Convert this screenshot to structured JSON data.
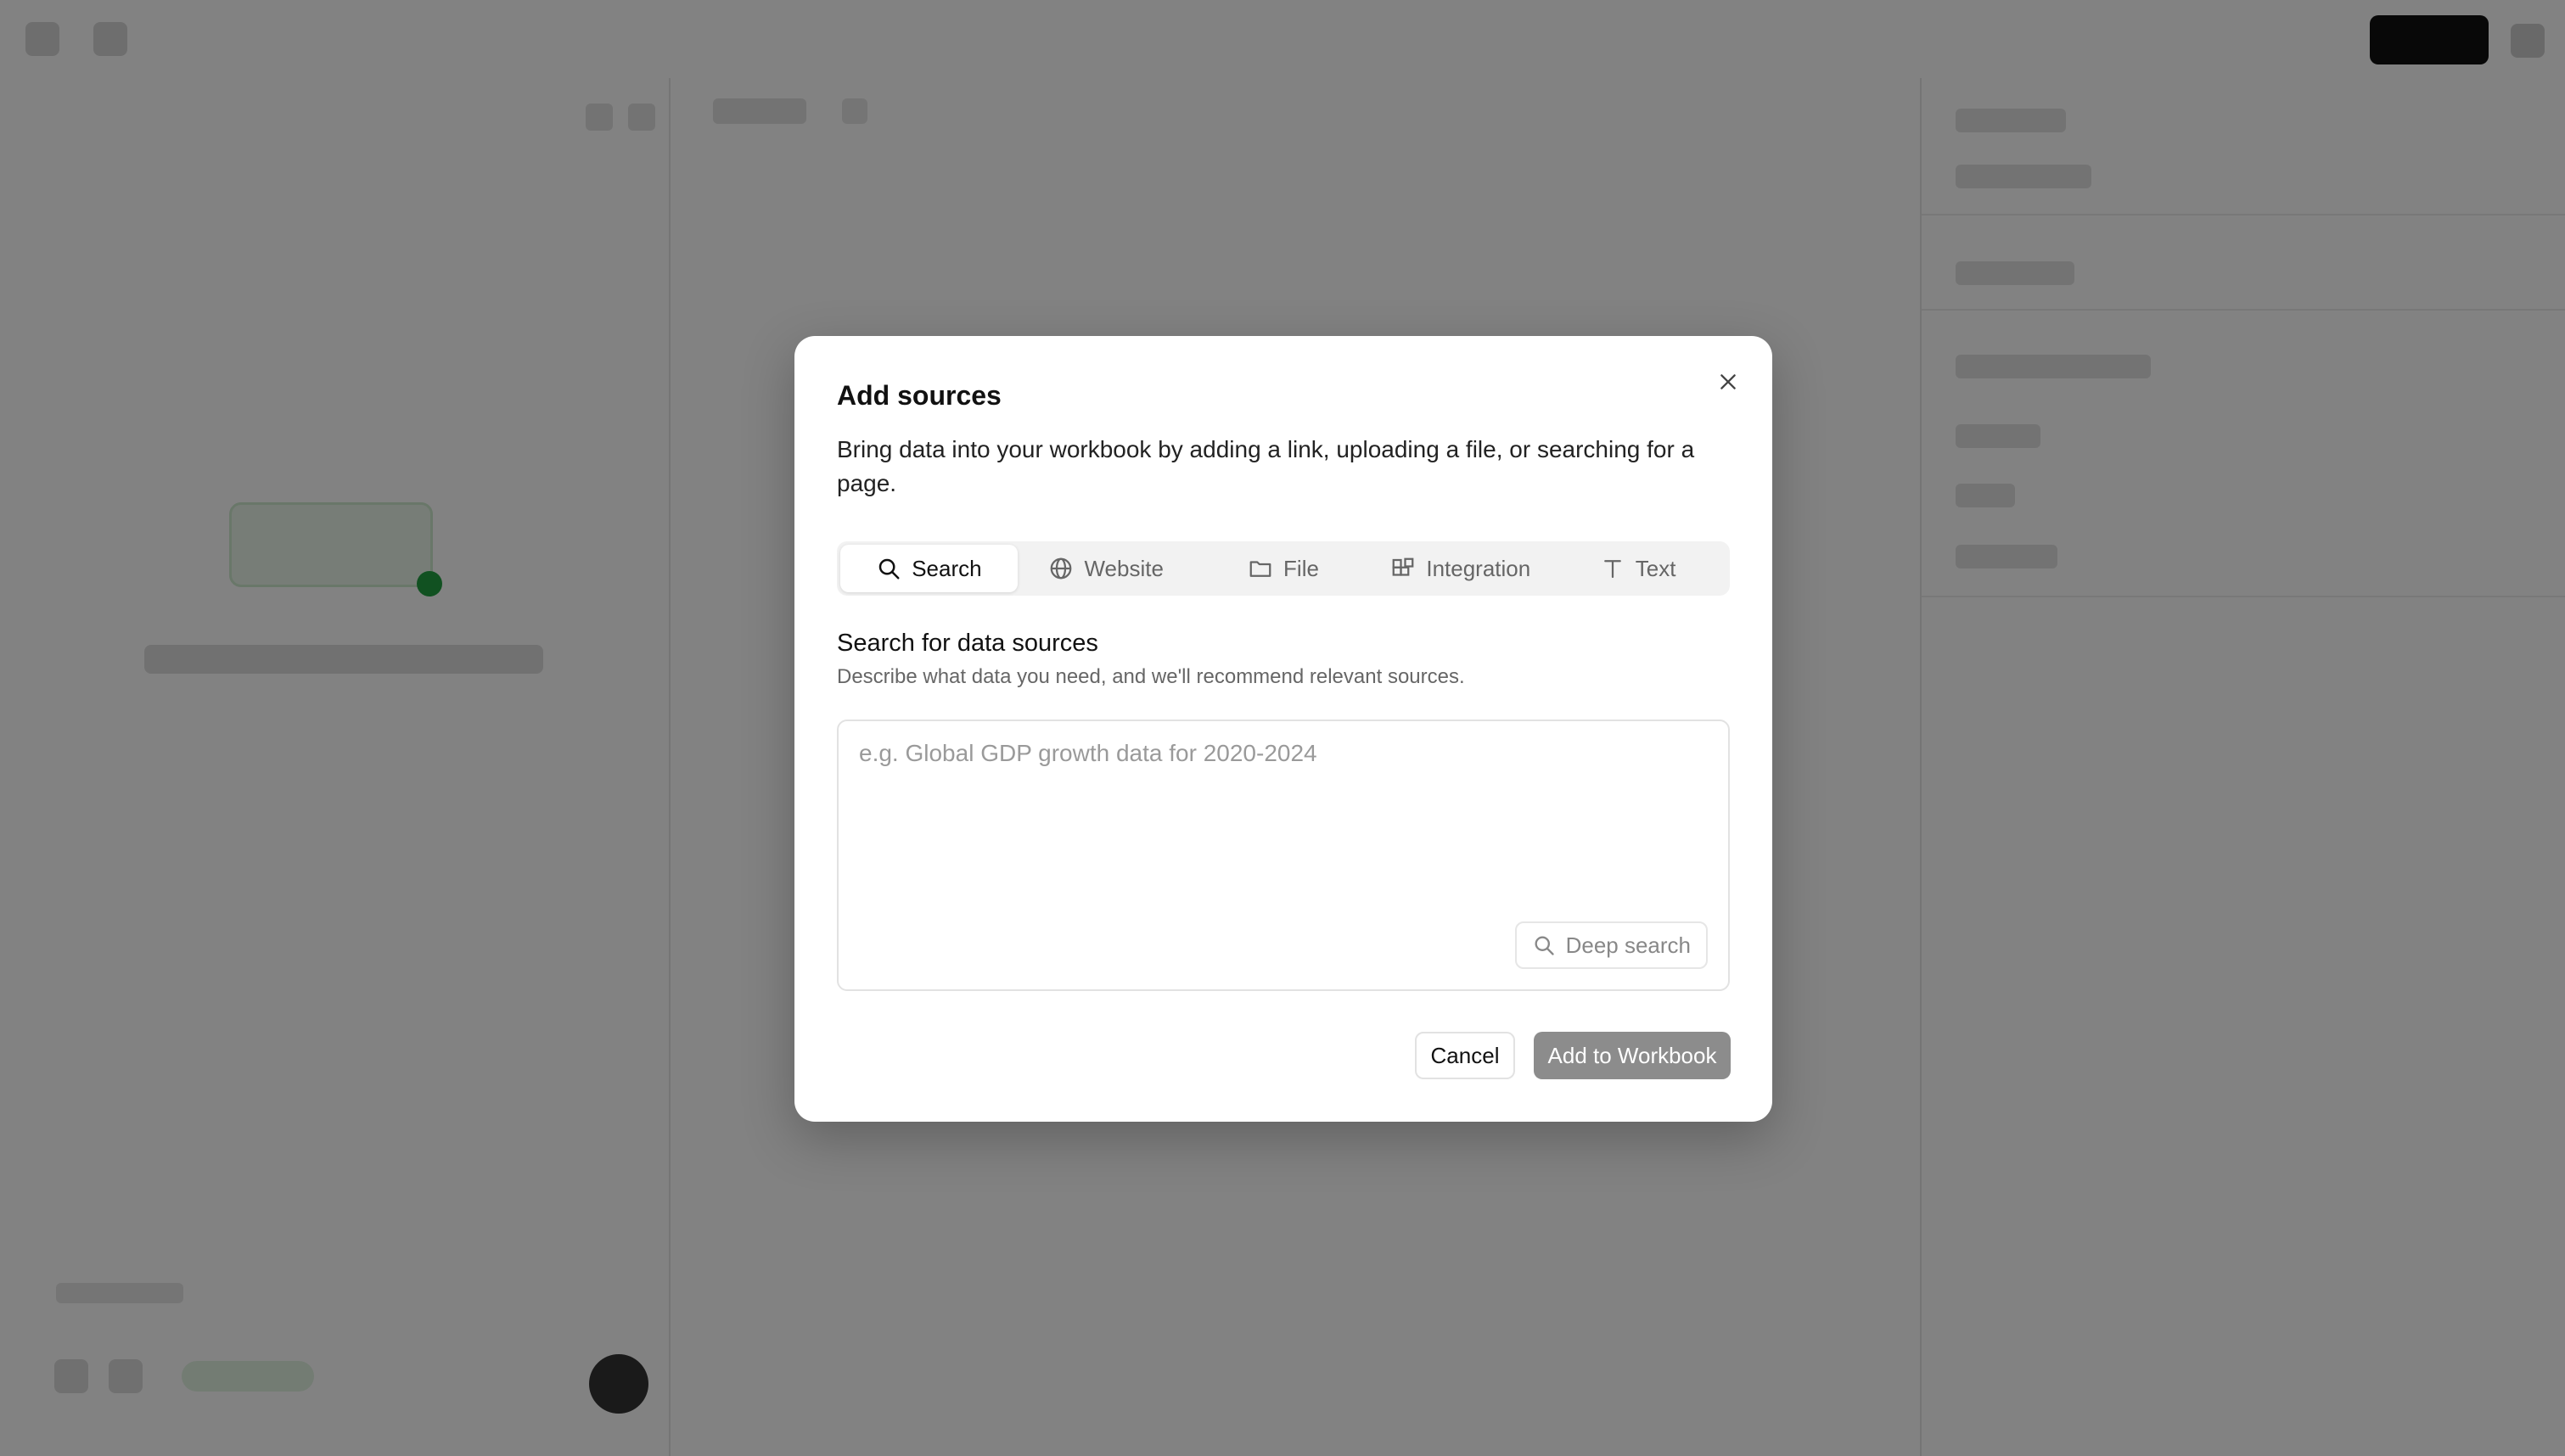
{
  "modal": {
    "title": "Add sources",
    "description": "Bring data into your workbook by adding a link, uploading a file, or searching for a page.",
    "close_icon": "close-icon",
    "tabs": [
      {
        "label": "Search",
        "icon": "search-icon",
        "active": true
      },
      {
        "label": "Website",
        "icon": "globe-icon",
        "active": false
      },
      {
        "label": "File",
        "icon": "folder-icon",
        "active": false
      },
      {
        "label": "Integration",
        "icon": "integration-icon",
        "active": false
      },
      {
        "label": "Text",
        "icon": "text-icon",
        "active": false
      }
    ],
    "search_section": {
      "title": "Search for data sources",
      "subtitle": "Describe what data you need, and we'll recommend relevant sources.",
      "placeholder": "e.g. Global GDP growth data for 2020-2024",
      "value": "",
      "deep_search_label": "Deep search"
    },
    "cancel_label": "Cancel",
    "add_label": "Add to Workbook"
  },
  "colors": {
    "overlay": "rgba(0,0,0,0.49)",
    "primary_disabled": "#8c8c8c",
    "accent_green": "#22a042"
  }
}
